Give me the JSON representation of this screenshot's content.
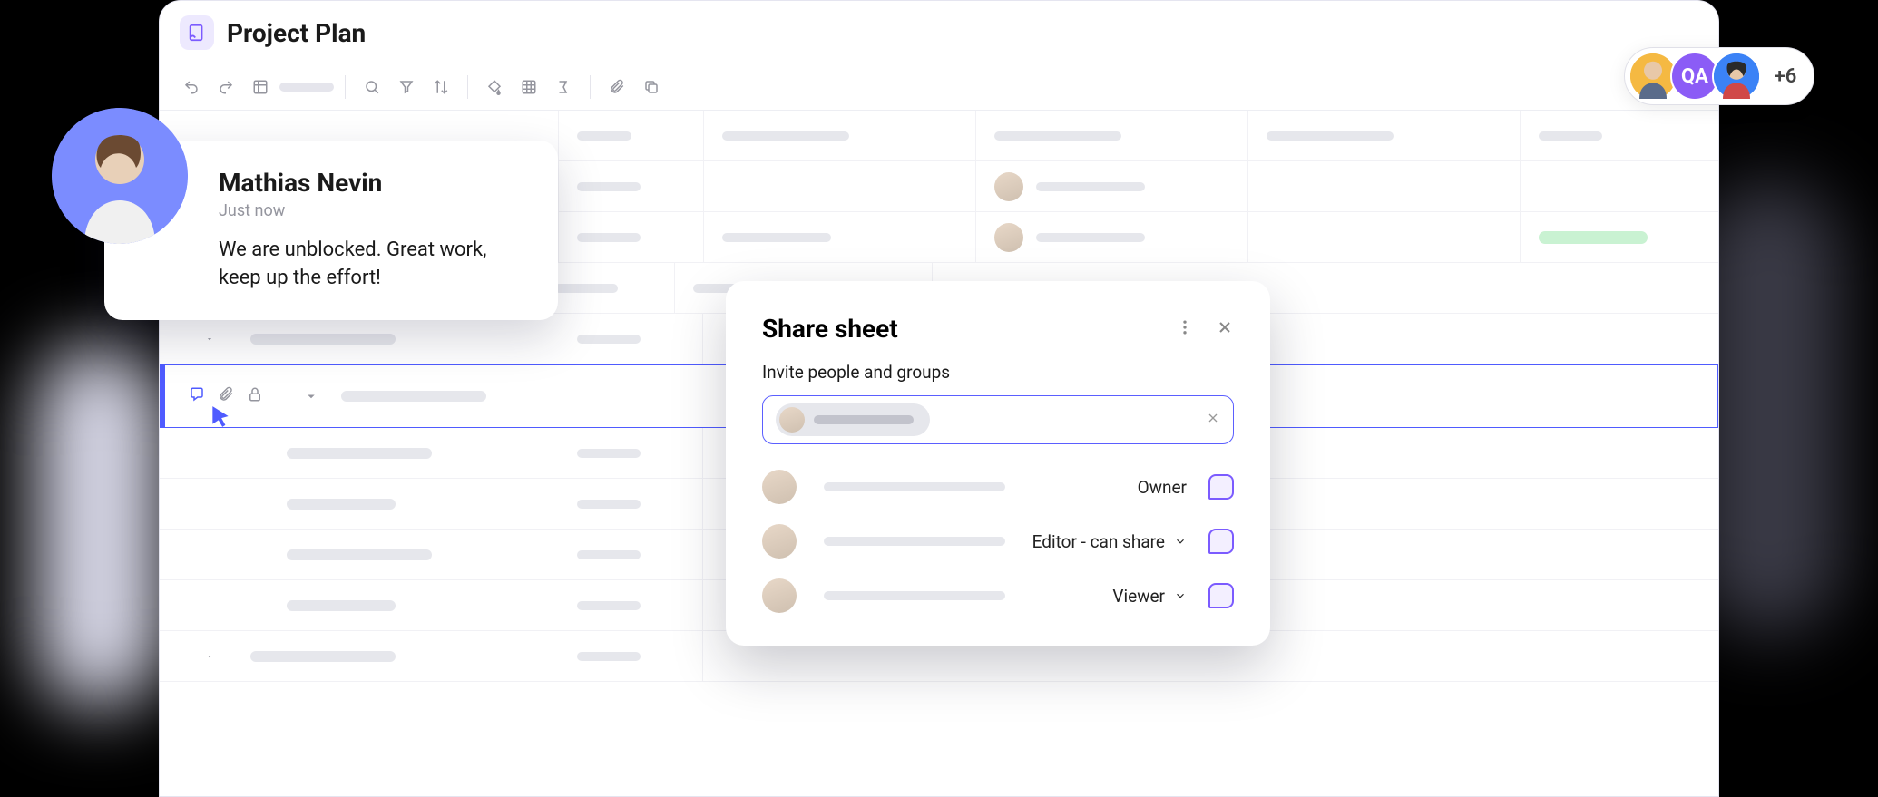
{
  "app": {
    "title": "Project Plan"
  },
  "comment": {
    "author": "Mathias Nevin",
    "time": "Just now",
    "body": "We are unblocked. Great work, keep up the effort!"
  },
  "presence": {
    "initials_user": "QA",
    "overflow": "+6"
  },
  "share": {
    "title": "Share sheet",
    "subtitle": "Invite people and groups",
    "roles": {
      "owner": "Owner",
      "editor": "Editor - can share",
      "viewer": "Viewer"
    }
  }
}
